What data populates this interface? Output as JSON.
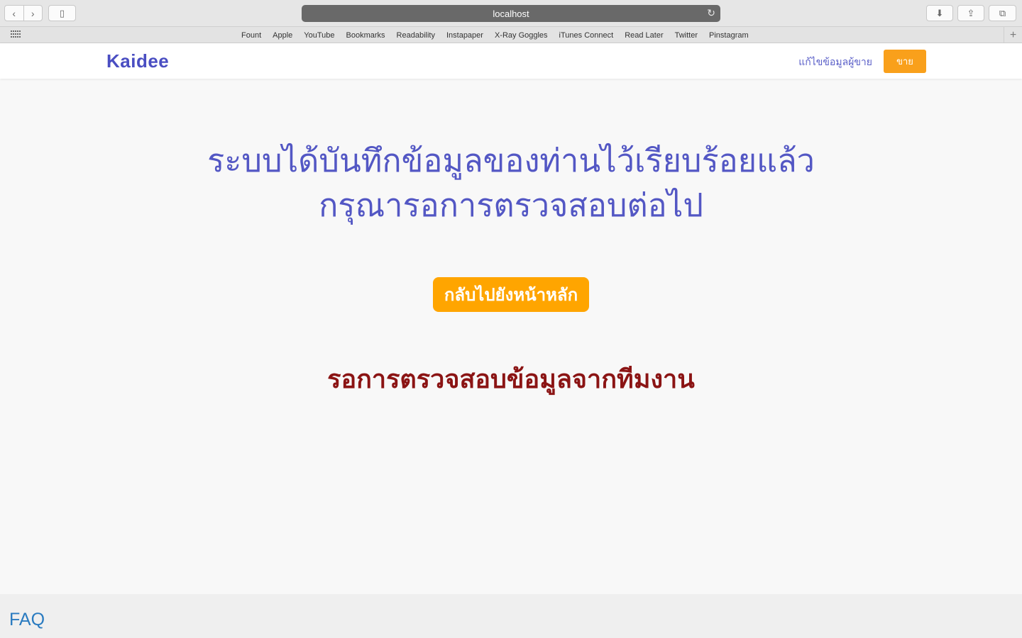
{
  "browser": {
    "url": "localhost",
    "bookmarks": [
      "Fount",
      "Apple",
      "YouTube",
      "Bookmarks",
      "Readability",
      "Instapaper",
      "X-Ray Goggles",
      "iTunes Connect",
      "Read Later",
      "Twitter",
      "Pinstagram"
    ],
    "icons": {
      "back": "chevron-left-icon",
      "forward": "chevron-right-icon",
      "sidebar": "sidebar-icon",
      "reload": "reload-icon",
      "download": "download-icon",
      "share": "share-icon",
      "tabs": "tabs-icon",
      "add": "plus-icon"
    }
  },
  "header": {
    "logo": "Kaidee",
    "edit_link": "แก้ไขข้อมูลผู้ขาย",
    "sell_button": "ขาย"
  },
  "main": {
    "headline_line1": "ระบบได้บันทึกข้อมูลของท่านไว้เรียบร้อยแล้ว",
    "headline_line2": "กรุณารอการตรวจสอบต่อไป",
    "home_button": "กลับไปยังหน้าหลัก",
    "status_text": "รอการตรวจสอบข้อมูลจากทีมงาน"
  },
  "footer": {
    "faq": "FAQ"
  },
  "colors": {
    "brand": "#4a4ec2",
    "headline": "#5357c4",
    "accent": "#ffa500",
    "status": "#8b1414",
    "link": "#2a7bc0"
  }
}
